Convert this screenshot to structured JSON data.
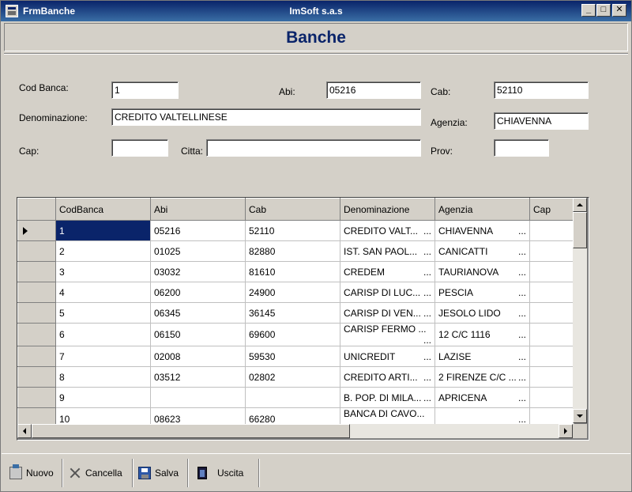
{
  "window": {
    "title": "FrmBanche",
    "company": "ImSoft s.a.s",
    "controls": {
      "minimize": "_",
      "maximize": "□",
      "close": "✕"
    }
  },
  "header": {
    "title": "Banche"
  },
  "form": {
    "cod_banca": {
      "label": "Cod Banca:",
      "value": "1"
    },
    "abi": {
      "label": "Abi:",
      "value": "05216"
    },
    "cab": {
      "label": "Cab:",
      "value": "52110"
    },
    "denominazione": {
      "label": "Denominazione:",
      "value": "CREDITO VALTELLINESE"
    },
    "agenzia": {
      "label": "Agenzia:",
      "value": "CHIAVENNA"
    },
    "cap": {
      "label": "Cap:",
      "value": ""
    },
    "citta": {
      "label": "Citta:",
      "value": ""
    },
    "prov": {
      "label": "Prov:",
      "value": ""
    }
  },
  "grid": {
    "columns": [
      "CodBanca",
      "Abi",
      "Cab",
      "Denominazione",
      "Agenzia",
      "Cap"
    ],
    "ellipsis": "...",
    "selected_index": 0,
    "rows": [
      {
        "cod": "1",
        "abi": "05216",
        "cab": "52110",
        "den": "CREDITO VALT...",
        "agenzia": "CHIAVENNA",
        "cap": ""
      },
      {
        "cod": "2",
        "abi": "01025",
        "cab": "82880",
        "den": "IST. SAN PAOL...",
        "agenzia": "CANICATTI",
        "cap": ""
      },
      {
        "cod": "3",
        "abi": "03032",
        "cab": "81610",
        "den": "CREDEM",
        "agenzia": "TAURIANOVA",
        "cap": ""
      },
      {
        "cod": "4",
        "abi": "06200",
        "cab": "24900",
        "den": "CARISP DI LUC...",
        "agenzia": "PESCIA",
        "cap": ""
      },
      {
        "cod": "5",
        "abi": "06345",
        "cab": "36145",
        "den": "CARISP DI VEN...",
        "agenzia": "JESOLO LIDO",
        "cap": ""
      },
      {
        "cod": "6",
        "abi": "06150",
        "cab": "69600",
        "den": "CARISP FERMO ...",
        "agenzia": "12 C/C 1116",
        "cap": ""
      },
      {
        "cod": "7",
        "abi": "02008",
        "cab": "59530",
        "den": "UNICREDIT",
        "agenzia": "LAZISE",
        "cap": ""
      },
      {
        "cod": "8",
        "abi": "03512",
        "cab": "02802",
        "den": "CREDITO ARTI...",
        "agenzia": "2 FIRENZE C/C ...",
        "cap": ""
      },
      {
        "cod": "9",
        "abi": "",
        "cab": "",
        "den": "B. POP. DI MILA...",
        "agenzia": "APRICENA",
        "cap": ""
      },
      {
        "cod": "10",
        "abi": "08623",
        "cab": "66280",
        "den": "BANCA DI CAVO...",
        "agenzia": "",
        "cap": ""
      }
    ]
  },
  "toolbar": {
    "nuovo": "Nuovo",
    "cancella": "Cancella",
    "salva": "Salva",
    "uscita": "Uscita"
  }
}
